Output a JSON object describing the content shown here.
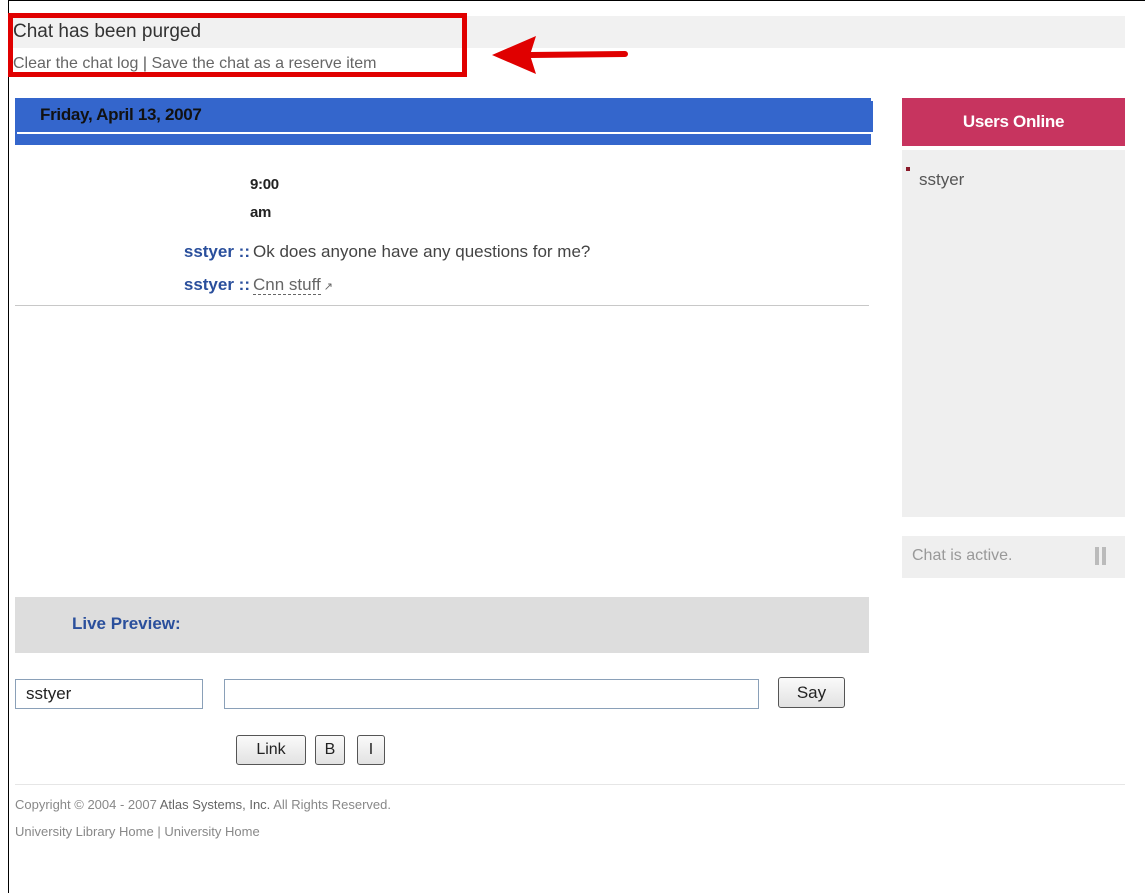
{
  "status": {
    "message": "Chat has been purged",
    "clear_link": "Clear the chat log",
    "separator": "|",
    "save_link": "Save the chat as a reserve item"
  },
  "chat": {
    "date": "Friday, April 13, 2007",
    "time_hour": "9:00",
    "time_period": "am",
    "messages": [
      {
        "user": "sstyer ::",
        "text": "Ok does anyone have any questions for me?"
      },
      {
        "user": "sstyer ::",
        "link_text": "Cnn stuff"
      }
    ]
  },
  "users_online": {
    "title": "Users Online",
    "users": [
      "sstyer"
    ]
  },
  "chat_status": {
    "text": "Chat is active."
  },
  "preview": {
    "label": "Live Preview:"
  },
  "compose": {
    "name_value": "sstyer",
    "message_value": "",
    "say_label": "Say",
    "link_label": "Link",
    "bold_label": "B",
    "italic_label": "I"
  },
  "footer": {
    "copyright_prefix": "Copyright © 2004 - 2007",
    "company": "Atlas Systems, Inc.",
    "copyright_suffix": "All Rights Reserved.",
    "library_home": "University Library Home",
    "separator": "|",
    "university_home": "University Home"
  },
  "colors": {
    "date_bar": "#3466cc",
    "users_header": "#c7345f",
    "highlight": "#e00000",
    "username": "#2a4f9c"
  },
  "icons": [
    "external-link-icon",
    "pause-icon",
    "bullet-icon",
    "red-arrow-icon"
  ]
}
